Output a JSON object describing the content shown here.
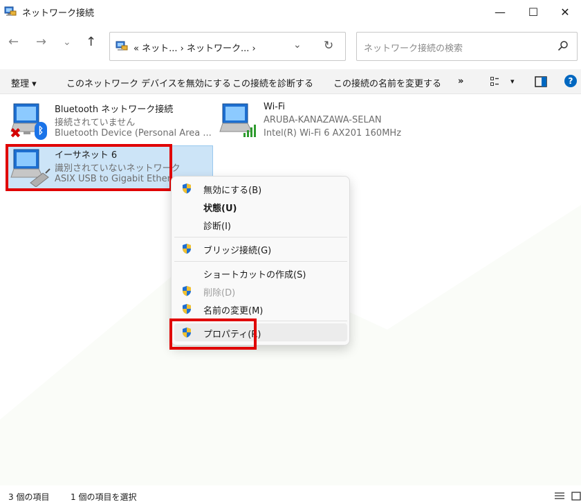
{
  "window": {
    "title": "ネットワーク接続",
    "minimize": "—",
    "maximize": "☐",
    "close": "✕"
  },
  "nav": {
    "back": "←",
    "forward": "→",
    "recent": "⌄",
    "up": "↑"
  },
  "address": {
    "path": "«  ネット...  ›  ネットワーク...  ›",
    "dropdown": "⌄",
    "refresh": "↻"
  },
  "search": {
    "placeholder": "ネットワーク接続の検索"
  },
  "commandbar": {
    "organize": "整理 ▾",
    "disable": "このネットワーク デバイスを無効にする",
    "diagnose": "この接続を診断する",
    "rename": "この接続の名前を変更する",
    "more": "»",
    "view_icon": "view-options-icon",
    "view_dd": "▾",
    "help": "?"
  },
  "connections": [
    {
      "name": "Bluetooth ネットワーク接続",
      "status": "接続されていません",
      "device": "Bluetooth Device (Personal Area ..."
    },
    {
      "name": "Wi-Fi",
      "status": "ARUBA-KANAZAWA-SELAN",
      "device": "Intel(R) Wi-Fi 6 AX201 160MHz"
    },
    {
      "name": "イーサネット 6",
      "status": "識別されていないネットワーク",
      "device": "ASIX USB to Gigabit Ethern"
    }
  ],
  "context_menu": {
    "items": [
      {
        "label": "無効にする(B)"
      },
      {
        "label": "状態(U)"
      },
      {
        "label": "診断(I)"
      },
      {
        "label": "ブリッジ接続(G)"
      },
      {
        "label": "ショートカットの作成(S)"
      },
      {
        "label": "削除(D)"
      },
      {
        "label": "名前の変更(M)"
      },
      {
        "label": "プロパティ(R)"
      }
    ]
  },
  "statusbar": {
    "count": "3 個の項目",
    "selected": "1 個の項目を選択"
  },
  "colors": {
    "highlight": "#e00000",
    "selection": "#cce4f7",
    "accent": "#0067c0"
  }
}
